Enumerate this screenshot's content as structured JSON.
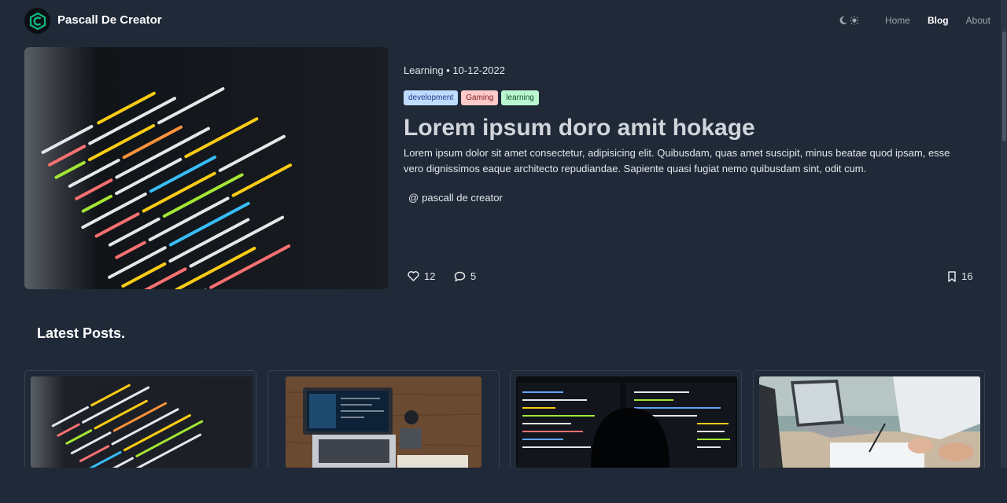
{
  "brand": {
    "name": "Pascall De Creator"
  },
  "nav": {
    "links": [
      {
        "label": "Home"
      },
      {
        "label": "Blog"
      },
      {
        "label": "About"
      }
    ]
  },
  "featured": {
    "category": "Learning",
    "date": "10-12-2022",
    "tags": [
      "development",
      "Gaming",
      "learning"
    ],
    "title": "Lorem ipsum doro amit hokage",
    "excerpt": "Lorem ipsum dolor sit amet consectetur, adipisicing elit. Quibusdam, quas amet suscipit, minus beatae quod ipsam, esse vero dignissimos eaque architecto repudiandae. Sapiente quasi fugiat nemo quibusdam sint, odit cum.",
    "author_prefix": "@",
    "author": "pascall de creator",
    "likes": "12",
    "comments": "5",
    "bookmarks": "16"
  },
  "latest": {
    "title": "Latest Posts."
  },
  "colors": {
    "background": "#1f2937",
    "accent": "#10b981"
  }
}
